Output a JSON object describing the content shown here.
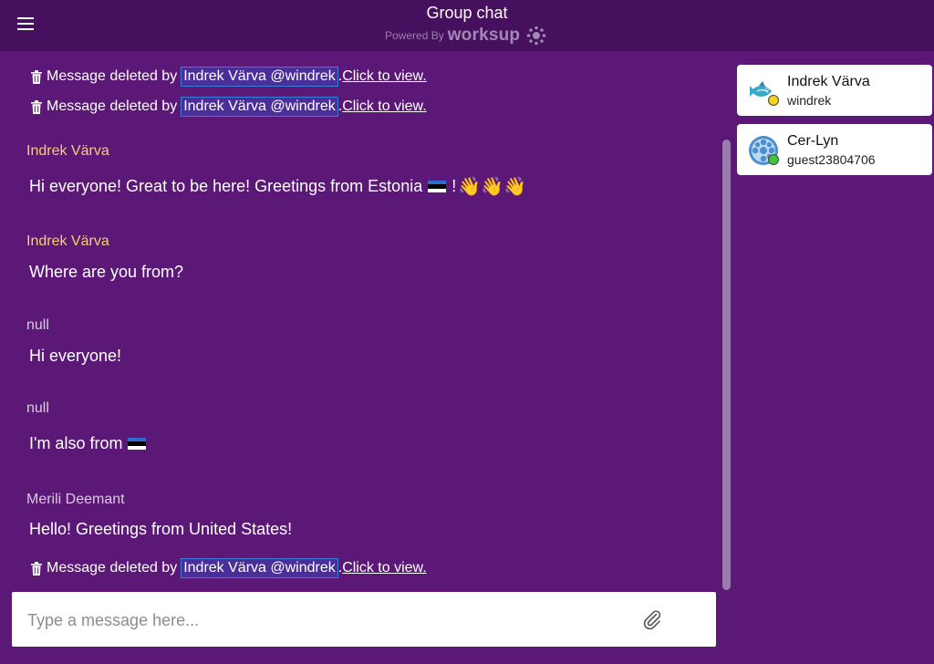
{
  "header": {
    "title": "Group chat",
    "powered_by": "Powered By",
    "brand": "worksup"
  },
  "deleted_notice": {
    "prefix": "Message deleted by",
    "mention": "Indrek Värva @windrek",
    "separator": ".",
    "link": "Click to view."
  },
  "messages": [
    {
      "sender": "Indrek Värva",
      "text": "Hi everyone! Great to be here! Greetings from Estonia",
      "suffix": "!",
      "emoji": "👋👋👋"
    },
    {
      "sender": "Indrek Värva",
      "text": "Where are you from?"
    },
    {
      "sender": "null",
      "text": "Hi everyone!"
    },
    {
      "sender": "null",
      "text": "I'm also from"
    },
    {
      "sender": "Merili Deemant",
      "text": "Hello! Greetings from United States!"
    }
  ],
  "input": {
    "placeholder": "Type a message here..."
  },
  "users": [
    {
      "name": "Indrek Värva",
      "handle": "windrek",
      "status_color": "#f5d21c",
      "avatar": "fish-icon"
    },
    {
      "name": "Cer-Lyn",
      "handle": "guest23804706",
      "status_color": "#3ec43e",
      "avatar": "reel-icon"
    }
  ],
  "colors": {
    "background": "#5b1877",
    "header": "#47105e",
    "sender_highlight": "#f0d36a",
    "mention_border": "#3d7bd9"
  }
}
